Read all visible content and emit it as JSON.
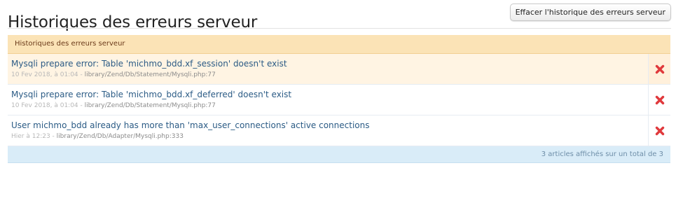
{
  "page": {
    "title": "Historiques des erreurs serveur",
    "clear_button": "Effacer l'historique des erreurs serveur"
  },
  "section": {
    "header": "Historiques des erreurs serveur",
    "rows": [
      {
        "title": "Mysqli prepare error: Table 'michmo_bdd.xf_session' doesn't exist",
        "date": "10 Fev 2018, à 01:04",
        "separator": " - ",
        "path": "library/Zend/Db/Statement/Mysqli.php:77",
        "highlighted": true
      },
      {
        "title": "Mysqli prepare error: Table 'michmo_bdd.xf_deferred' doesn't exist",
        "date": "10 Fev 2018, à 01:04",
        "separator": " - ",
        "path": "library/Zend/Db/Statement/Mysqli.php:77",
        "highlighted": false
      },
      {
        "title": "User michmo_bdd already has more than 'max_user_connections' active connections",
        "date": "Hier à 12:23",
        "separator": " - ",
        "path": "library/Zend/Db/Adapter/Mysqli.php:333",
        "highlighted": false
      }
    ],
    "footer": "3 articles affichés sur un total de 3"
  },
  "icons": {
    "delete": "delete-x-icon"
  },
  "colors": {
    "header_bg": "#fbe3b6",
    "link": "#2b5b85",
    "delete": "#e0393c",
    "footer_bg": "#d9ecf8"
  }
}
